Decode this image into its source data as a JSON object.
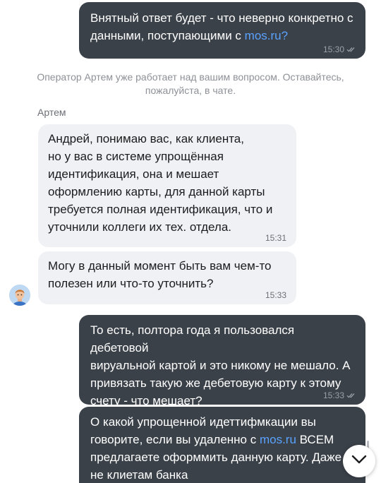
{
  "messages": [
    {
      "direction": "out",
      "parts": [
        {
          "text": "Внятный ответ будет - что неверно конкретно с\nданными, поступающими с "
        },
        {
          "text": "mos.ru?",
          "link": true
        }
      ],
      "time": "15:30",
      "read": true
    },
    {
      "direction": "in",
      "text": "Андрей, понимаю вас, как клиента,\nно у вас в системе упрощённая\nидентификация, она и мешает\nоформлению карты, для данной карты\nтребуется полная идентификация, что и\nуточнили коллеги их тех. отдела.",
      "time": "15:31"
    },
    {
      "direction": "in",
      "text": "Могу в данный момент быть вам чем-то\nполезен или что-то уточнить?",
      "time": "15:33"
    },
    {
      "direction": "out",
      "text": "То есть, полтора года я пользовался дебетовой\nвируальной картой и это никому не мешало. А\nпривязать такую же дебетовую карту к этому\nсчету - что мешает?",
      "time": "15:33",
      "read": true
    },
    {
      "direction": "out",
      "parts": [
        {
          "text": "О какой упрощенной идеттифмкации вы\nговорите, если вы удаленно с "
        },
        {
          "text": "mos.ru",
          "link": true
        },
        {
          "text": " ВСЕМ\nпредлагаете оформмить данную карту. Даже\nне клиетам банка"
        }
      ]
    }
  ],
  "system_note": "Оператор Артем уже работает над вашим вопросом. Оставайтесь, пожалуйста, в чате.",
  "operator_name": "Артем",
  "icons": {
    "read_receipt": "double-check-icon",
    "scroll_down": "chevron-down-icon",
    "avatar": "operator-avatar-icon"
  },
  "colors": {
    "outgoing_bubble": "#3b4149",
    "incoming_bubble": "#eff1f4",
    "link": "#5aa2ff"
  }
}
